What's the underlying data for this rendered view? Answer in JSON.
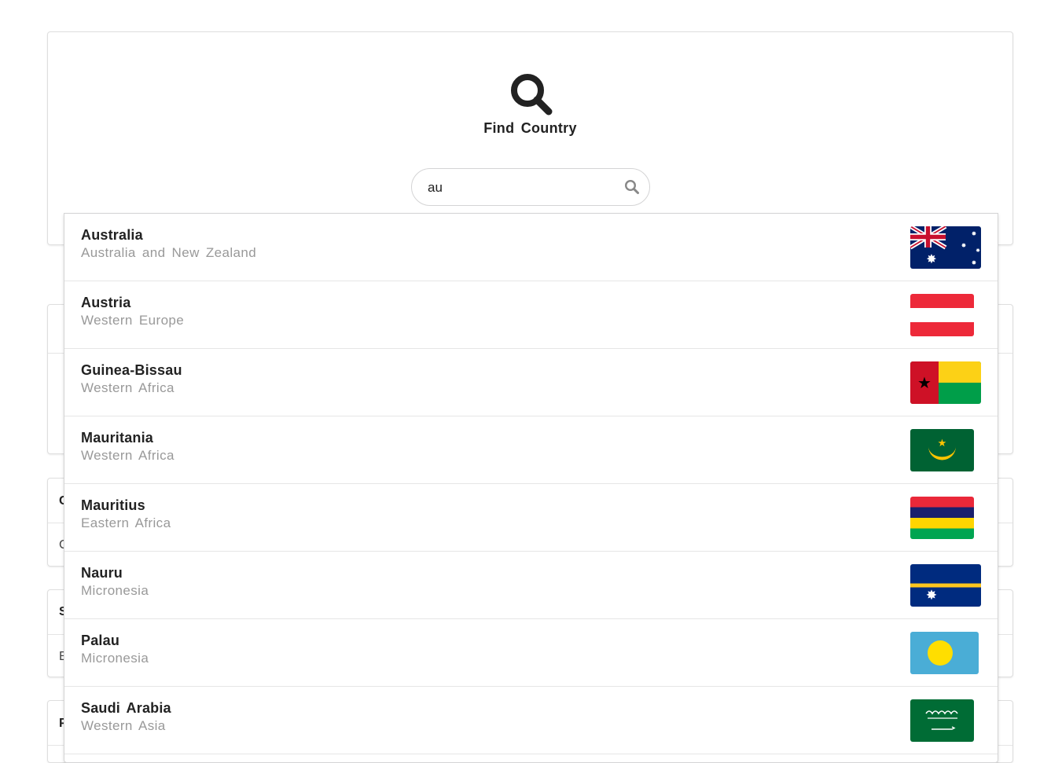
{
  "header": {
    "title": "Find Country",
    "icon": "search-icon"
  },
  "search": {
    "value": "au",
    "placeholder": "",
    "button_icon": "search-icon"
  },
  "background": {
    "cards": [
      {
        "label": "C",
        "value": "C"
      },
      {
        "label": "S",
        "value": "E"
      },
      {
        "label": "P"
      }
    ]
  },
  "results": [
    {
      "name": "Australia",
      "region": "Australia and New Zealand",
      "flag": "australia-flag"
    },
    {
      "name": "Austria",
      "region": "Western Europe",
      "flag": "austria-flag"
    },
    {
      "name": "Guinea-Bissau",
      "region": "Western Africa",
      "flag": "guinea-bissau-flag"
    },
    {
      "name": "Mauritania",
      "region": "Western Africa",
      "flag": "mauritania-flag"
    },
    {
      "name": "Mauritius",
      "region": "Eastern Africa",
      "flag": "mauritius-flag"
    },
    {
      "name": "Nauru",
      "region": "Micronesia",
      "flag": "nauru-flag"
    },
    {
      "name": "Palau",
      "region": "Micronesia",
      "flag": "palau-flag"
    },
    {
      "name": "Saudi Arabia",
      "region": "Western Asia",
      "flag": "saudi-arabia-flag"
    }
  ],
  "colors": {
    "text": "#222222",
    "muted": "#999999",
    "border": "#d4d4d5"
  }
}
